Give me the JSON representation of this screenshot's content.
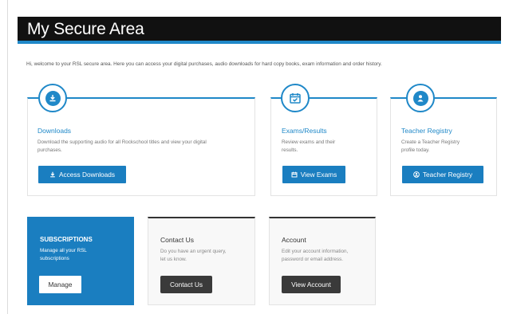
{
  "header": {
    "title": "My Secure Area"
  },
  "welcome_text": "Hi, welcome to your RSL secure area. Here you can access your digital purchases, audio downloads for hard copy books, exam information and order history.",
  "cards": {
    "downloads": {
      "title": "Downloads",
      "description": "Download the supporting audio for all Rockschool titles and view your digital purchases.",
      "button": "Access Downloads",
      "icon": "download-icon"
    },
    "exams": {
      "title": "Exams/Results",
      "description": "Review exams and their results.",
      "button": "View Exams",
      "icon": "calendar-check-icon"
    },
    "teacher": {
      "title": "Teacher Registry",
      "description": "Create a Teacher Registry profile today.",
      "button": "Teacher Registry",
      "icon": "user-icon"
    }
  },
  "subscriptions": {
    "title": "SUBSCRIPTIONS",
    "description": "Manage all your RSL subscriptions",
    "button": "Manage"
  },
  "contact": {
    "title": "Contact Us",
    "description": "Do you have an urgent query, let us know.",
    "button": "Contact Us"
  },
  "account": {
    "title": "Account",
    "description": "Edit your account information, password or email address.",
    "button": "View Account"
  },
  "colors": {
    "accent": "#1f88c8",
    "header_bg": "#111111",
    "dark_button": "#3a3a3a"
  }
}
